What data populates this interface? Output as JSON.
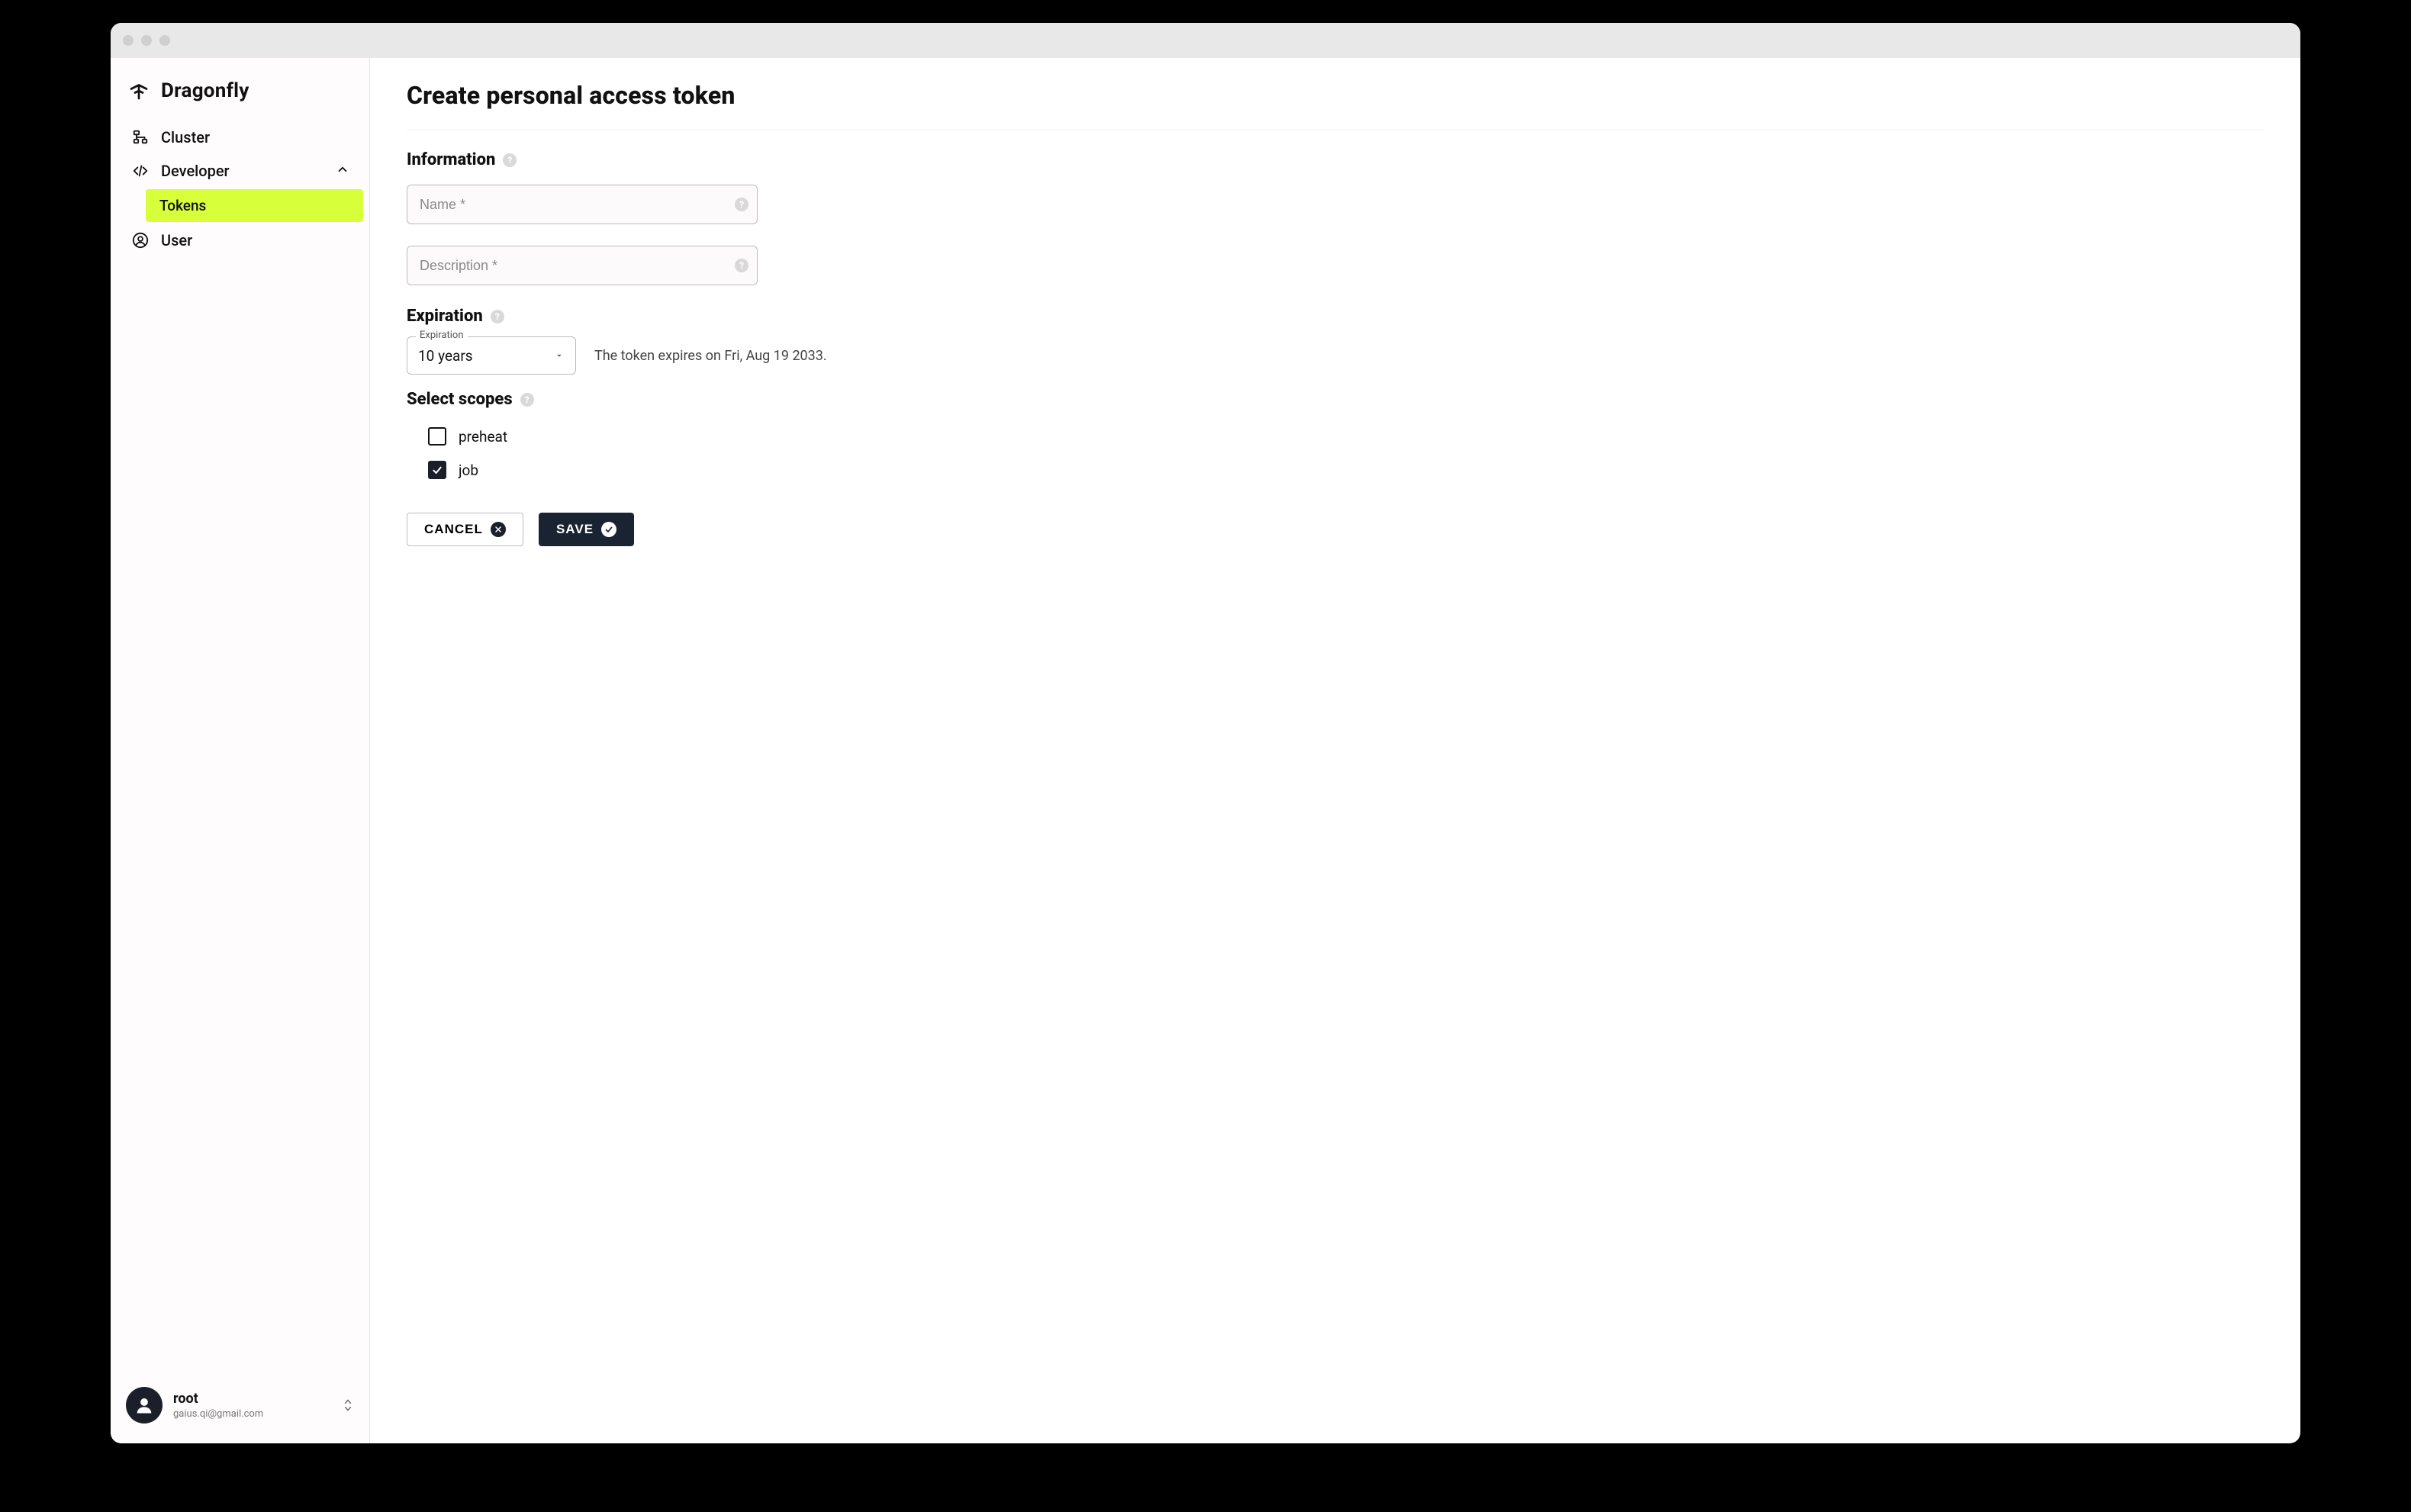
{
  "brand": {
    "name": "Dragonfly"
  },
  "sidebar": {
    "cluster": "Cluster",
    "developer": "Developer",
    "tokens": "Tokens",
    "user_nav": "User"
  },
  "user": {
    "name": "root",
    "email": "gaius.qi@gmail.com"
  },
  "page": {
    "title": "Create personal access token",
    "section_information": "Information",
    "section_expiration": "Expiration",
    "section_scopes": "Select scopes"
  },
  "fields": {
    "name_placeholder": "Name *",
    "description_placeholder": "Description *"
  },
  "expiration": {
    "legend": "Expiration",
    "value": "10 years",
    "hint": "The token expires on Fri, Aug 19 2033."
  },
  "scopes": {
    "preheat": {
      "label": "preheat",
      "checked": false
    },
    "job": {
      "label": "job",
      "checked": true
    }
  },
  "buttons": {
    "cancel": "CANCEL",
    "save": "SAVE"
  }
}
